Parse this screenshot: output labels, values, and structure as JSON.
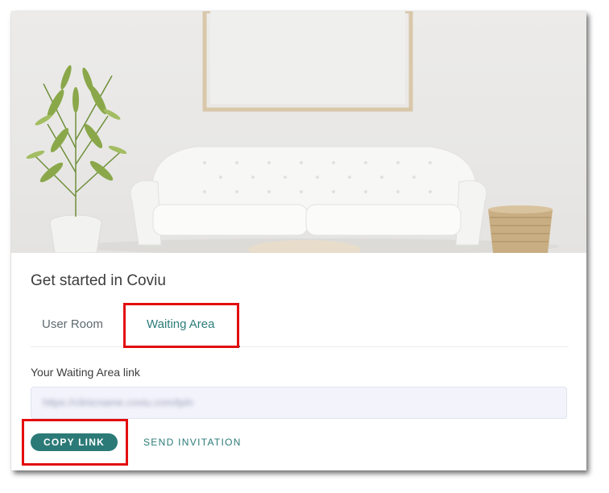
{
  "header": {
    "title": "Get started in Coviu"
  },
  "tabs": [
    {
      "label": "User Room",
      "active": false
    },
    {
      "label": "Waiting Area",
      "active": true
    }
  ],
  "waiting_area": {
    "link_label": "Your Waiting Area link",
    "link_value": "https://clinicname.coviu.com/tpln",
    "copy_button": "COPY LINK",
    "send_button": "SEND INVITATION"
  },
  "colors": {
    "accent": "#2b7a77",
    "highlight": "#e30d0d"
  },
  "hero": {
    "image": "living-room-illustration"
  }
}
